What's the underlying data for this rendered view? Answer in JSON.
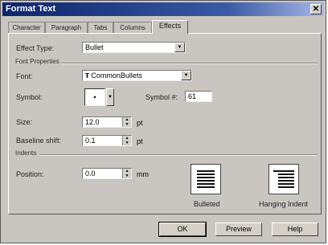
{
  "window": {
    "title": "Format Text",
    "close_label": "✕"
  },
  "tabs": [
    "Character",
    "Paragraph",
    "Tabs",
    "Columns",
    "Effects"
  ],
  "effect_type": {
    "label": "Effect Type:",
    "value": "Bullet"
  },
  "font_properties": {
    "section_label": "Font Properties",
    "font": {
      "label": "Font:",
      "value": "CommonBullets",
      "icon": "font-type-icon"
    },
    "symbol": {
      "label": "Symbol:",
      "value": "•"
    },
    "symbol_number": {
      "label": "Symbol #:",
      "value": "61"
    },
    "size": {
      "label": "Size:",
      "value": "12.0",
      "unit": "pt"
    },
    "baseline_shift": {
      "label": "Baseline shift:",
      "value": "0.1",
      "unit": "pt"
    }
  },
  "indents": {
    "section_label": "Indents",
    "position": {
      "label": "Position:",
      "value": "0.0",
      "unit": "mm"
    },
    "options": [
      "Bulleted",
      "Hanging Indent"
    ]
  },
  "buttons": {
    "ok": "OK",
    "preview": "Preview",
    "help": "Help"
  }
}
